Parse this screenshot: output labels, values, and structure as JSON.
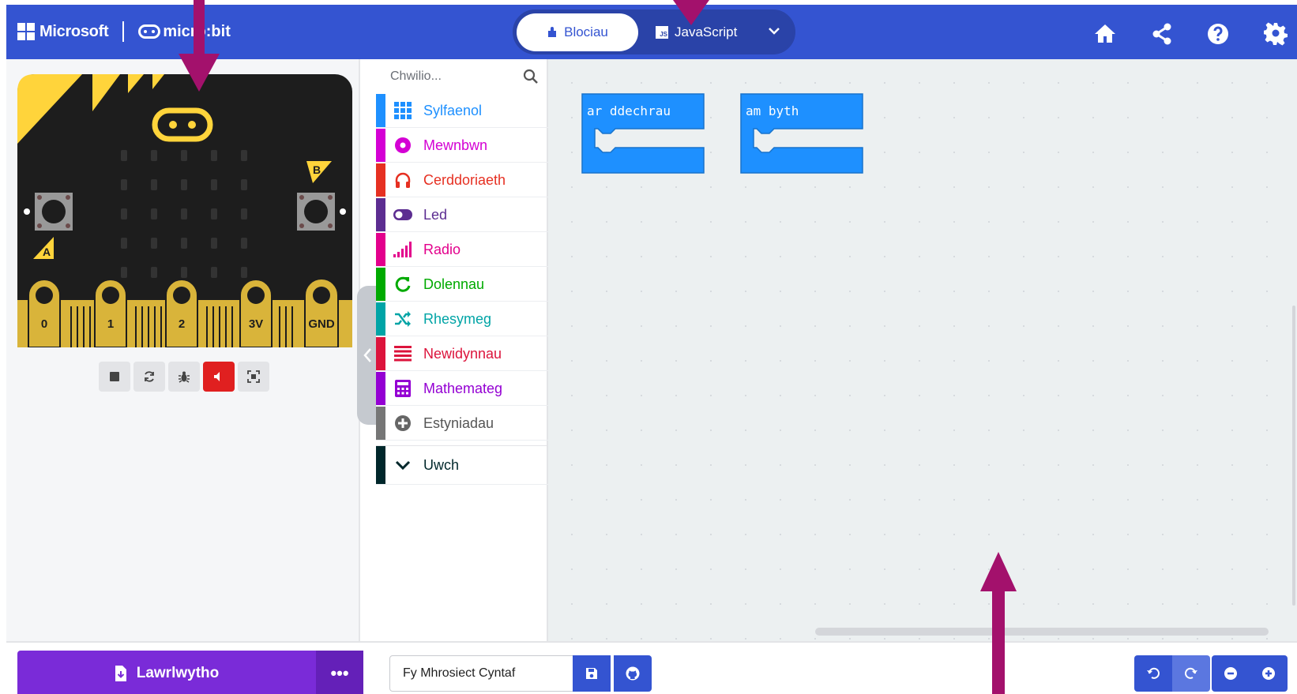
{
  "header": {
    "brand_microsoft": "Microsoft",
    "brand_microbit": "micro:bit",
    "mode_blocks": "Blociau",
    "mode_javascript": "JavaScript",
    "js_badge": "JS",
    "icons": [
      "home-icon",
      "share-icon",
      "help-icon",
      "settings-icon"
    ]
  },
  "simulator": {
    "pins": [
      "0",
      "1",
      "2",
      "3V",
      "GND"
    ],
    "button_a": "A",
    "button_b": "B",
    "toolbar": [
      "stop-icon",
      "restart-icon",
      "debug-icon",
      "mute-icon",
      "fullscreen-icon"
    ]
  },
  "toolbox": {
    "search_placeholder": "Chwilio...",
    "categories": [
      {
        "label": "Sylfaenol",
        "color": "#1e90ff",
        "icon": "grid-icon"
      },
      {
        "label": "Mewnbwn",
        "color": "#d400d4",
        "icon": "input-circle-icon"
      },
      {
        "label": "Cerddoriaeth",
        "color": "#e63022",
        "icon": "headphones-icon"
      },
      {
        "label": "Led",
        "color": "#5c2d91",
        "icon": "toggle-icon"
      },
      {
        "label": "Radio",
        "color": "#e3008c",
        "icon": "signal-bars-icon"
      },
      {
        "label": "Dolennau",
        "color": "#00aa00",
        "icon": "loop-icon"
      },
      {
        "label": "Rhesymeg",
        "color": "#00a4a6",
        "icon": "shuffle-icon"
      },
      {
        "label": "Newidynnau",
        "color": "#dc143c",
        "icon": "list-lines-icon"
      },
      {
        "label": "Mathemateg",
        "color": "#9400d3",
        "icon": "calculator-icon"
      },
      {
        "label": "Estyniadau",
        "color": "#767676",
        "icon": "plus-circle-icon"
      }
    ],
    "advanced": {
      "label": "Uwch",
      "color": "#00272b",
      "icon": "chevron-down-icon"
    }
  },
  "workspace": {
    "blocks": [
      {
        "label": "ar ddechrau",
        "color": "#1e90ff"
      },
      {
        "label": "am byth",
        "color": "#1e90ff"
      }
    ]
  },
  "footer": {
    "download_label": "Lawrlwytho",
    "more_label": "•••",
    "project_name": "Fy Mhrosiect Cyntaf"
  },
  "accent": {
    "header": "#3454d1",
    "download": "#7a2bd8",
    "arrow": "#a3116c"
  }
}
